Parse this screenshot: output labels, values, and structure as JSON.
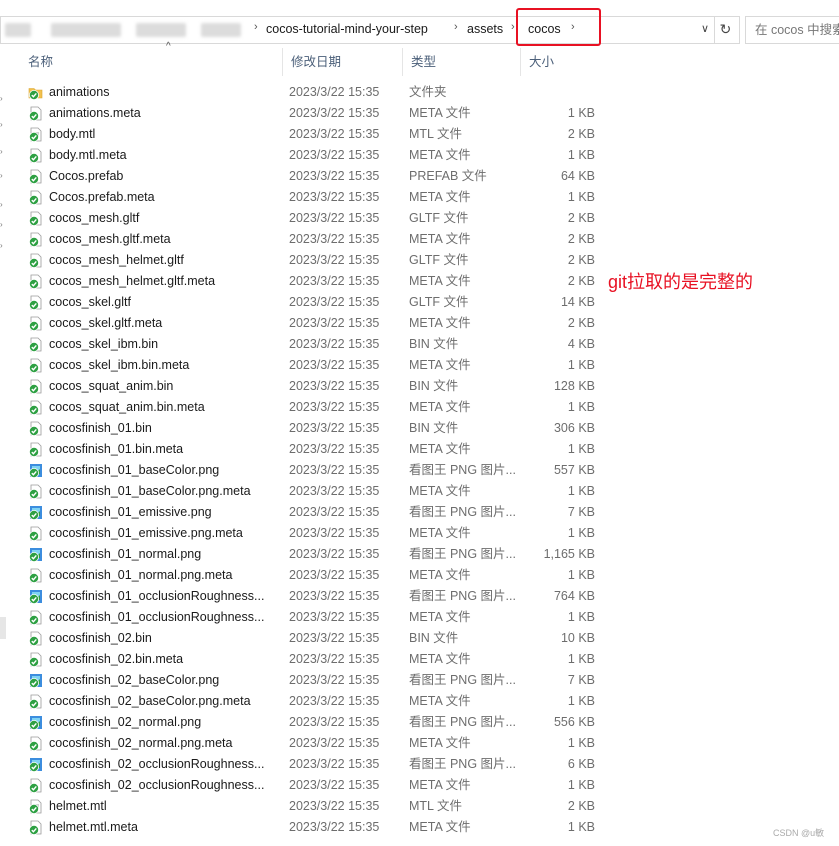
{
  "address_bar": {
    "crumbs": [
      "cocos-tutorial-mind-your-step",
      "assets",
      "cocos"
    ],
    "search_placeholder": "在 cocos 中搜索"
  },
  "columns": {
    "name": "名称",
    "date": "修改日期",
    "type": "类型",
    "size": "大小"
  },
  "files": [
    {
      "name": "animations",
      "date": "2023/3/22 15:35",
      "type": "文件夹",
      "size": "",
      "icon": "folder"
    },
    {
      "name": "animations.meta",
      "date": "2023/3/22 15:35",
      "type": "META 文件",
      "size": "1 KB",
      "icon": "doc"
    },
    {
      "name": "body.mtl",
      "date": "2023/3/22 15:35",
      "type": "MTL 文件",
      "size": "2 KB",
      "icon": "mtl"
    },
    {
      "name": "body.mtl.meta",
      "date": "2023/3/22 15:35",
      "type": "META 文件",
      "size": "1 KB",
      "icon": "doc"
    },
    {
      "name": "Cocos.prefab",
      "date": "2023/3/22 15:35",
      "type": "PREFAB 文件",
      "size": "64 KB",
      "icon": "doc"
    },
    {
      "name": "Cocos.prefab.meta",
      "date": "2023/3/22 15:35",
      "type": "META 文件",
      "size": "1 KB",
      "icon": "doc"
    },
    {
      "name": "cocos_mesh.gltf",
      "date": "2023/3/22 15:35",
      "type": "GLTF 文件",
      "size": "2 KB",
      "icon": "doc"
    },
    {
      "name": "cocos_mesh.gltf.meta",
      "date": "2023/3/22 15:35",
      "type": "META 文件",
      "size": "2 KB",
      "icon": "doc"
    },
    {
      "name": "cocos_mesh_helmet.gltf",
      "date": "2023/3/22 15:35",
      "type": "GLTF 文件",
      "size": "2 KB",
      "icon": "doc"
    },
    {
      "name": "cocos_mesh_helmet.gltf.meta",
      "date": "2023/3/22 15:35",
      "type": "META 文件",
      "size": "2 KB",
      "icon": "doc"
    },
    {
      "name": "cocos_skel.gltf",
      "date": "2023/3/22 15:35",
      "type": "GLTF 文件",
      "size": "14 KB",
      "icon": "doc"
    },
    {
      "name": "cocos_skel.gltf.meta",
      "date": "2023/3/22 15:35",
      "type": "META 文件",
      "size": "2 KB",
      "icon": "doc"
    },
    {
      "name": "cocos_skel_ibm.bin",
      "date": "2023/3/22 15:35",
      "type": "BIN 文件",
      "size": "4 KB",
      "icon": "doc"
    },
    {
      "name": "cocos_skel_ibm.bin.meta",
      "date": "2023/3/22 15:35",
      "type": "META 文件",
      "size": "1 KB",
      "icon": "doc"
    },
    {
      "name": "cocos_squat_anim.bin",
      "date": "2023/3/22 15:35",
      "type": "BIN 文件",
      "size": "128 KB",
      "icon": "doc"
    },
    {
      "name": "cocos_squat_anim.bin.meta",
      "date": "2023/3/22 15:35",
      "type": "META 文件",
      "size": "1 KB",
      "icon": "doc"
    },
    {
      "name": "cocosfinish_01.bin",
      "date": "2023/3/22 15:35",
      "type": "BIN 文件",
      "size": "306 KB",
      "icon": "doc"
    },
    {
      "name": "cocosfinish_01.bin.meta",
      "date": "2023/3/22 15:35",
      "type": "META 文件",
      "size": "1 KB",
      "icon": "doc"
    },
    {
      "name": "cocosfinish_01_baseColor.png",
      "date": "2023/3/22 15:35",
      "type": "看图王 PNG 图片...",
      "size": "557 KB",
      "icon": "png"
    },
    {
      "name": "cocosfinish_01_baseColor.png.meta",
      "date": "2023/3/22 15:35",
      "type": "META 文件",
      "size": "1 KB",
      "icon": "doc"
    },
    {
      "name": "cocosfinish_01_emissive.png",
      "date": "2023/3/22 15:35",
      "type": "看图王 PNG 图片...",
      "size": "7 KB",
      "icon": "png"
    },
    {
      "name": "cocosfinish_01_emissive.png.meta",
      "date": "2023/3/22 15:35",
      "type": "META 文件",
      "size": "1 KB",
      "icon": "doc"
    },
    {
      "name": "cocosfinish_01_normal.png",
      "date": "2023/3/22 15:35",
      "type": "看图王 PNG 图片...",
      "size": "1,165 KB",
      "icon": "png"
    },
    {
      "name": "cocosfinish_01_normal.png.meta",
      "date": "2023/3/22 15:35",
      "type": "META 文件",
      "size": "1 KB",
      "icon": "doc"
    },
    {
      "name": "cocosfinish_01_occlusionRoughness...",
      "date": "2023/3/22 15:35",
      "type": "看图王 PNG 图片...",
      "size": "764 KB",
      "icon": "png"
    },
    {
      "name": "cocosfinish_01_occlusionRoughness...",
      "date": "2023/3/22 15:35",
      "type": "META 文件",
      "size": "1 KB",
      "icon": "doc"
    },
    {
      "name": "cocosfinish_02.bin",
      "date": "2023/3/22 15:35",
      "type": "BIN 文件",
      "size": "10 KB",
      "icon": "doc"
    },
    {
      "name": "cocosfinish_02.bin.meta",
      "date": "2023/3/22 15:35",
      "type": "META 文件",
      "size": "1 KB",
      "icon": "doc"
    },
    {
      "name": "cocosfinish_02_baseColor.png",
      "date": "2023/3/22 15:35",
      "type": "看图王 PNG 图片...",
      "size": "7 KB",
      "icon": "png"
    },
    {
      "name": "cocosfinish_02_baseColor.png.meta",
      "date": "2023/3/22 15:35",
      "type": "META 文件",
      "size": "1 KB",
      "icon": "doc"
    },
    {
      "name": "cocosfinish_02_normal.png",
      "date": "2023/3/22 15:35",
      "type": "看图王 PNG 图片...",
      "size": "556 KB",
      "icon": "png"
    },
    {
      "name": "cocosfinish_02_normal.png.meta",
      "date": "2023/3/22 15:35",
      "type": "META 文件",
      "size": "1 KB",
      "icon": "doc"
    },
    {
      "name": "cocosfinish_02_occlusionRoughness...",
      "date": "2023/3/22 15:35",
      "type": "看图王 PNG 图片...",
      "size": "6 KB",
      "icon": "png"
    },
    {
      "name": "cocosfinish_02_occlusionRoughness...",
      "date": "2023/3/22 15:35",
      "type": "META 文件",
      "size": "1 KB",
      "icon": "doc"
    },
    {
      "name": "helmet.mtl",
      "date": "2023/3/22 15:35",
      "type": "MTL 文件",
      "size": "2 KB",
      "icon": "mtl"
    },
    {
      "name": "helmet.mtl.meta",
      "date": "2023/3/22 15:35",
      "type": "META 文件",
      "size": "1 KB",
      "icon": "doc"
    }
  ],
  "annotation": "git拉取的是完整的",
  "watermark": "CSDN @u敏",
  "colors": {
    "highlight_box": "#e81123",
    "annotation_text": "#e81123",
    "header_text": "#4c607a",
    "sync_badge": "#2ea043"
  }
}
